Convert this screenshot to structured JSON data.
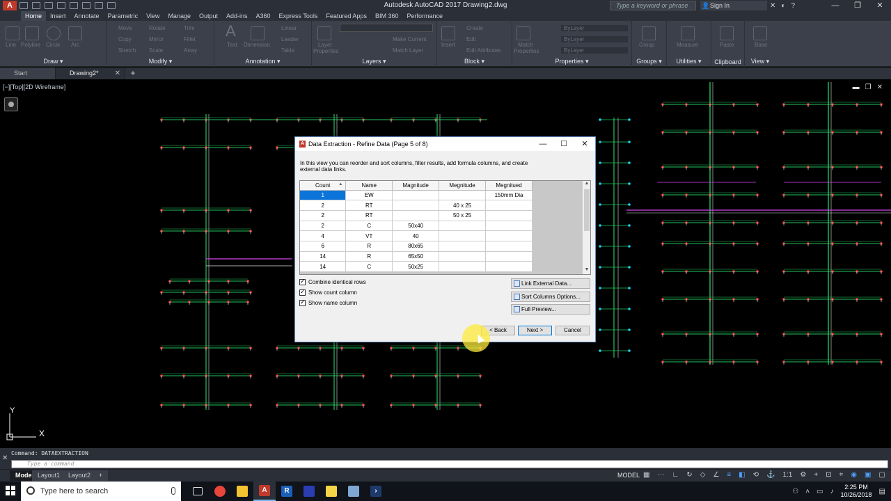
{
  "window": {
    "title": "Autodesk AutoCAD 2017    Drawing2.dwg",
    "search_placeholder": "Type a keyword or phrase",
    "signin_label": "Sign In",
    "logo": "A"
  },
  "ribbon_tabs": [
    "Home",
    "Insert",
    "Annotate",
    "Parametric",
    "View",
    "Manage",
    "Output",
    "Add-ins",
    "A360",
    "Express Tools",
    "Featured Apps",
    "BIM 360",
    "Performance"
  ],
  "ribbon_panels": {
    "draw": "Draw ▾",
    "modify": "Modify ▾",
    "annotation": "Annotation ▾",
    "layers": "Layers ▾",
    "block": "Block ▾",
    "properties": "Properties ▾",
    "groups": "Groups ▾",
    "utilities": "Utilities ▾",
    "clipboard": "Clipboard",
    "view": "View ▾"
  },
  "ribbon_tools": {
    "line": "Line",
    "polyline": "Polyline",
    "circle": "Circle",
    "arc": "Arc",
    "move": "Move",
    "rotate": "Rotate",
    "trim": "Trim",
    "copy": "Copy",
    "mirror": "Mirror",
    "fillet": "Fillet",
    "stretch": "Stretch",
    "scale": "Scale",
    "array": "Array",
    "text": "Text",
    "dimension": "Dimension",
    "linear": "Linear",
    "leader": "Leader",
    "table": "Table",
    "layer_properties": "Layer Properties",
    "make_current": "Make Current",
    "match_layer": "Match Layer",
    "insert": "Insert",
    "create": "Create",
    "edit": "Edit",
    "edit_attributes": "Edit Attributes",
    "match_properties": "Match Properties",
    "bylayer1": "ByLayer",
    "bylayer2": "ByLayer",
    "bylayer3": "ByLayer",
    "group": "Group",
    "measure": "Measure",
    "paste": "Paste",
    "base": "Base"
  },
  "doc_tabs": {
    "start": "Start",
    "drawing": "Drawing2*"
  },
  "viewport": {
    "label": "[−][Top][2D Wireframe]",
    "x_axis": "X",
    "y_axis": "Y"
  },
  "command": {
    "history": "Command: DATAEXTRACTION",
    "placeholder": "Type a command"
  },
  "layout_tabs": [
    "Model",
    "Layout1",
    "Layout2"
  ],
  "status": {
    "model": "MODEL",
    "scale": "1:1"
  },
  "taskbar": {
    "search_placeholder": "Type here to search",
    "time": "2:25 PM",
    "date": "10/26/2018"
  },
  "dialog": {
    "title": "Data Extraction - Refine Data (Page 5 of 8)",
    "description": "In this view you can reorder and sort columns, filter results, add formula columns, and create external data links.",
    "columns": [
      "Count",
      "Name",
      "Magnitude",
      "Megnitude",
      "Megnitued"
    ],
    "rows": [
      [
        "1",
        "EW",
        "",
        "",
        "150mm Dia"
      ],
      [
        "2",
        "RT",
        "",
        "40 x 25",
        ""
      ],
      [
        "2",
        "RT",
        "",
        "50 x 25",
        ""
      ],
      [
        "2",
        "C",
        "50x40",
        "",
        ""
      ],
      [
        "4",
        "VT",
        "40",
        "",
        ""
      ],
      [
        "6",
        "R",
        "80x65",
        "",
        ""
      ],
      [
        "14",
        "R",
        "65x50",
        "",
        ""
      ],
      [
        "14",
        "C",
        "50x25",
        "",
        ""
      ]
    ],
    "checkboxes": {
      "combine": "Combine identical rows",
      "count": "Show count column",
      "name": "Show name column"
    },
    "buttons": {
      "link": "Link External Data...",
      "sort": "Sort Columns Options...",
      "preview": "Full Preview...",
      "back": "< Back",
      "next": "Next >",
      "cancel": "Cancel"
    }
  }
}
